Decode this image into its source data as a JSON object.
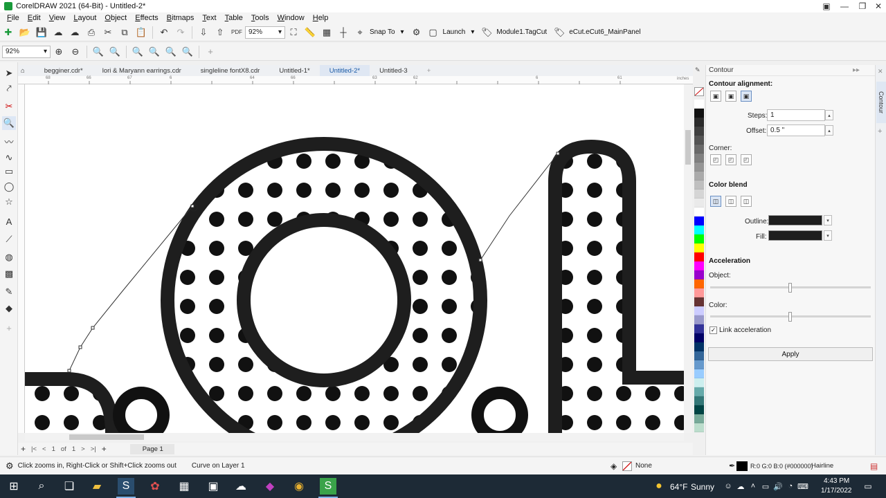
{
  "window": {
    "title": "CorelDRAW 2021 (64-Bit) - Untitled-2*"
  },
  "menu": [
    "File",
    "Edit",
    "View",
    "Layout",
    "Object",
    "Effects",
    "Bitmaps",
    "Text",
    "Table",
    "Tools",
    "Window",
    "Help"
  ],
  "toolbar": {
    "zoom_value": "92%",
    "pdf_label": "PDF",
    "snap_to": "Snap To",
    "launch": "Launch",
    "module1": "Module1.TagCut",
    "ecut": "eCut.eCut6_MainPanel"
  },
  "property_bar": {
    "zoom_value": "92%"
  },
  "tabs": [
    "begginer.cdr*",
    "lori & Maryann earrings.cdr",
    "singleline fontX8.cdr",
    "Untitled-1*",
    "Untitled-2*",
    "Untitled-3"
  ],
  "active_tab_index": 4,
  "ruler_unit": "inches",
  "ruler_ticks": [
    "68",
    "66",
    "67",
    "6",
    "64",
    "66",
    "63",
    "62",
    "6",
    "61"
  ],
  "page_nav": {
    "current": "1",
    "of_label": "of",
    "total": "1",
    "page_label": "Page 1"
  },
  "docker": {
    "title": "Contour",
    "side_tab": "Contour",
    "contour_alignment_label": "Contour alignment:",
    "steps_label": "Steps:",
    "steps_value": "1",
    "offset_label": "Offset:",
    "offset_value": "0.5 \"",
    "corner_label": "Corner:",
    "color_blend_label": "Color blend",
    "outline_label": "Outline:",
    "fill_label": "Fill:",
    "acceleration_label": "Acceleration",
    "object_label": "Object:",
    "color_label": "Color:",
    "object_acceleration": 0.5,
    "color_acceleration": 0.5,
    "link_acceleration_label": "Link acceleration",
    "link_acceleration_checked": true,
    "apply_label": "Apply",
    "outline_color": "#1e1e1e",
    "fill_color": "#1e1e1e"
  },
  "palette": [
    "#ffffff",
    "#111111",
    "#2b2b2b",
    "#404040",
    "#555555",
    "#6a6a6a",
    "#808080",
    "#959595",
    "#aaaaaa",
    "#bfbfbf",
    "#d5d5d5",
    "#eaeaea",
    "#ffffff",
    "#0000ff",
    "#00ffff",
    "#00ff00",
    "#ffff00",
    "#ff0000",
    "#ff00ff",
    "#9900cc",
    "#ff6600",
    "#ff9999",
    "#663333",
    "#ccccff",
    "#9999cc",
    "#333399",
    "#000066",
    "#003366",
    "#336699",
    "#6699cc",
    "#99ccff",
    "#cceeee",
    "#66aaaa",
    "#337777",
    "#004444",
    "#77aa99",
    "#bbddcc"
  ],
  "status": {
    "hint": "Click zooms in, Right-Click or Shift+Click zooms out",
    "selection": "Curve on Layer 1",
    "fill": "None",
    "outline_color": "R:0 G:0 B:0 (#000000)",
    "outline_width": "Hairline"
  },
  "taskbar": {
    "weather_temp": "64°F",
    "weather_desc": "Sunny",
    "time": "4:43 PM",
    "date": "1/17/2022"
  }
}
